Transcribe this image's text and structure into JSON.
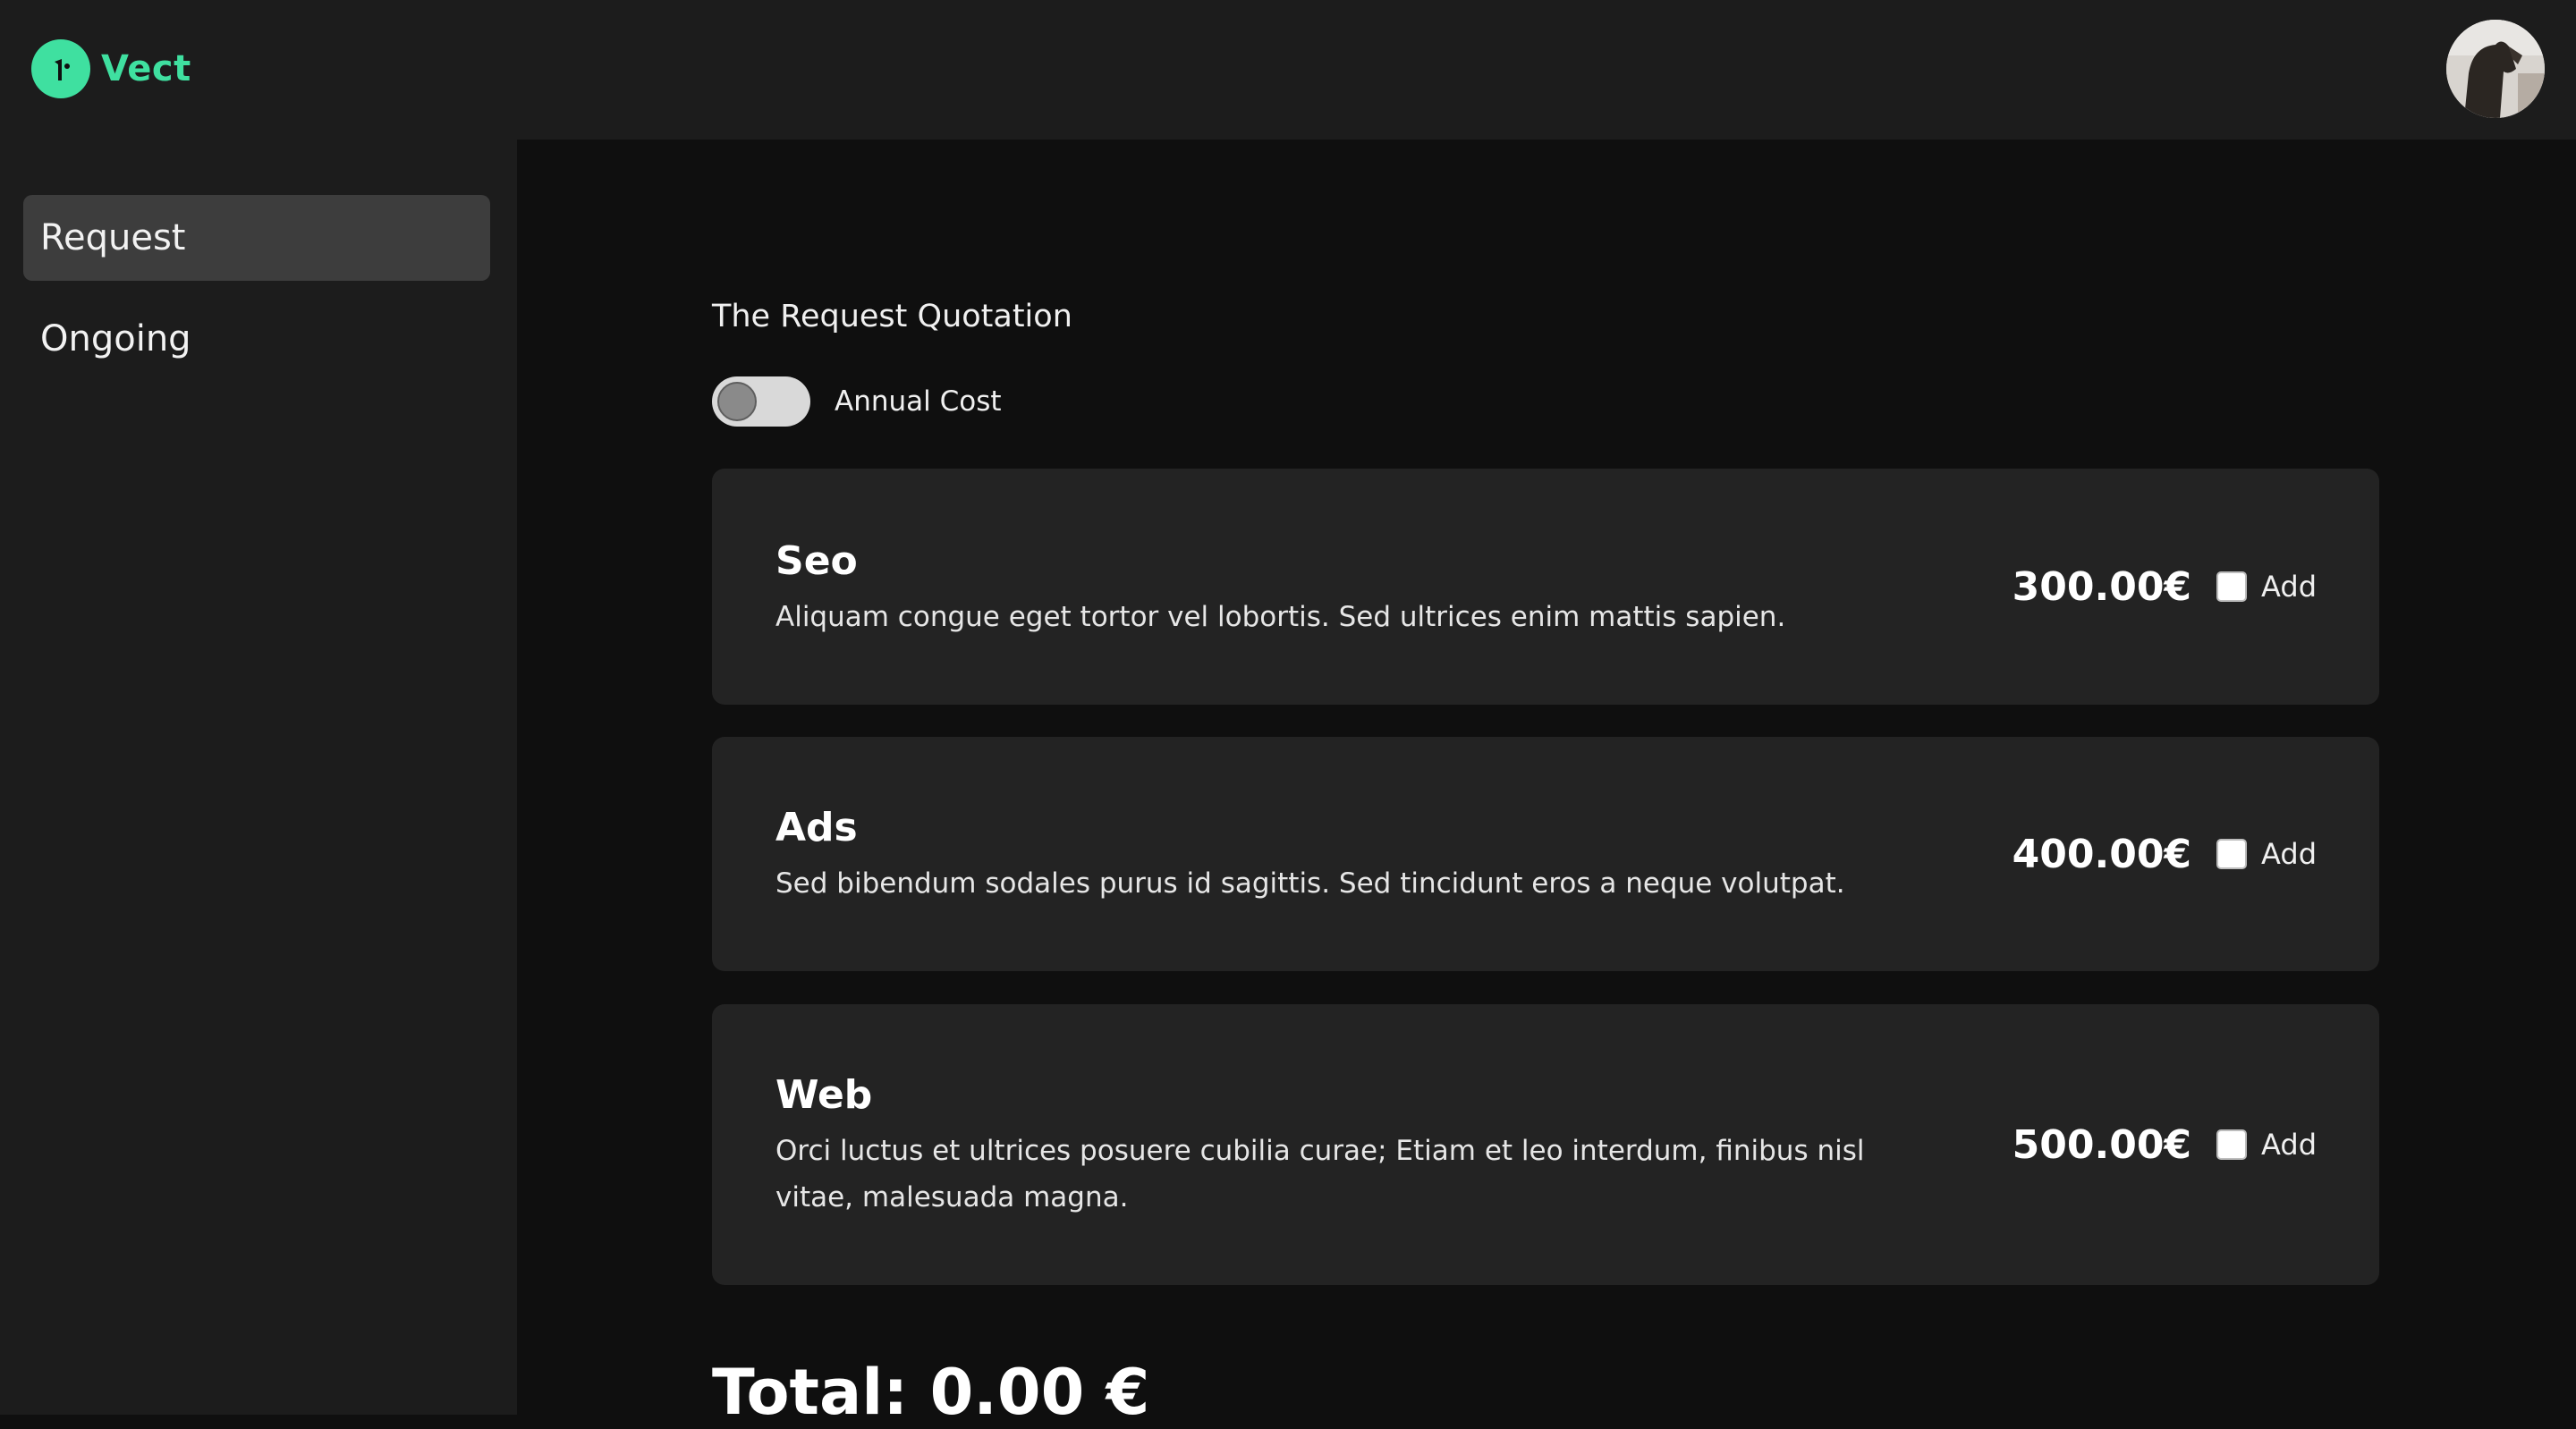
{
  "header": {
    "brand_name": "Vect",
    "brand_color": "#3fe0a0",
    "logo_icon": "leaf-logo-icon",
    "avatar_icon": "user-avatar"
  },
  "sidebar": {
    "items": [
      {
        "label": "Request",
        "active": true
      },
      {
        "label": "Ongoing",
        "active": false
      }
    ]
  },
  "main": {
    "heading": "The Request Quotation",
    "toggle": {
      "label": "Annual Cost",
      "checked": false
    },
    "services": [
      {
        "title": "Seo",
        "description": "Aliquam congue eget tortor vel lobortis. Sed ultrices enim mattis sapien.",
        "price": "300.00€",
        "add_label": "Add",
        "checked": false
      },
      {
        "title": "Ads",
        "description": "Sed bibendum sodales purus id sagittis. Sed tincidunt eros a neque volutpat.",
        "price": "400.00€",
        "add_label": "Add",
        "checked": false
      },
      {
        "title": "Web",
        "description": "Orci luctus et ultrices posuere cubilia curae; Etiam et leo interdum, finibus nisl vitae, malesuada magna.",
        "price": "500.00€",
        "add_label": "Add",
        "checked": false
      }
    ],
    "total": "Total: 0.00 €"
  }
}
